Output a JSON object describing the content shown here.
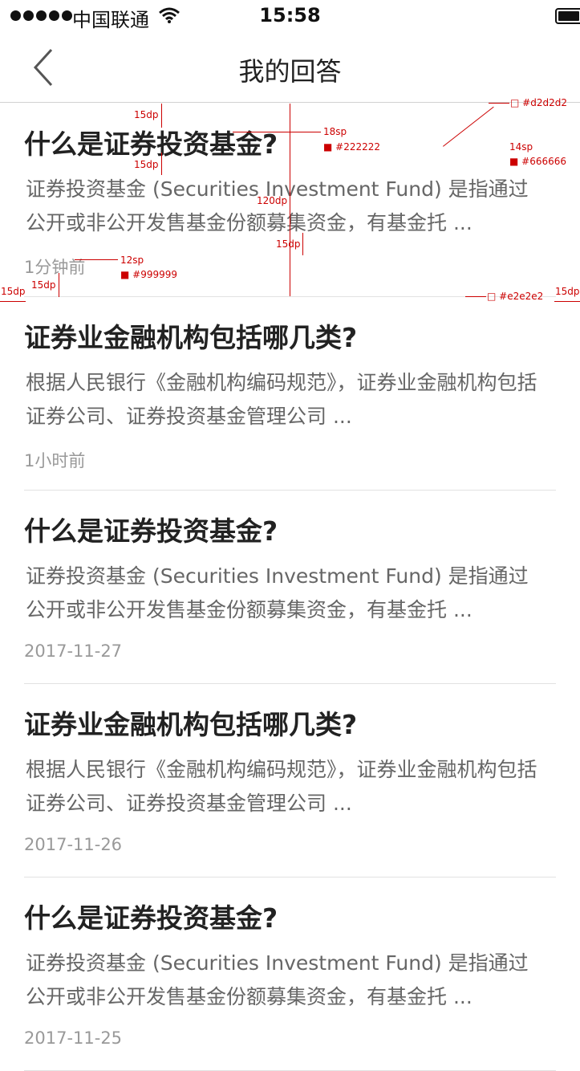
{
  "status_bar": {
    "carrier": "中国联通",
    "time": "15:58"
  },
  "nav": {
    "title": "我的回答",
    "back_icon": "chevron-left-icon"
  },
  "items": [
    {
      "title": "什么是证券投资基金?",
      "body": "证券投资基金 (Securities Investment Fund) 是指通过公开或非公开发售基金份额募集资金，有基金托 ...",
      "time": "1分钟前"
    },
    {
      "title": "证券业金融机构包括哪几类?",
      "body": "根据人民银行《金融机构编码规范》，证券业金融机构包括证券公司、证券投资基金管理公司 ...",
      "time": "1小时前"
    },
    {
      "title": "什么是证券投资基金?",
      "body": "证券投资基金 (Securities Investment Fund) 是指通过公开或非公开发售基金份额募集资金，有基金托 ...",
      "time": "2017-11-27"
    },
    {
      "title": "证券业金融机构包括哪几类?",
      "body": "根据人民银行《金融机构编码规范》，证券业金融机构包括证券公司、证券投资基金管理公司 ...",
      "time": "2017-11-26"
    },
    {
      "title": "什么是证券投资基金?",
      "body": "证券投资基金 (Securities Investment Fund) 是指通过公开或非公开发售基金份额募集资金，有基金托 ...",
      "time": "2017-11-25"
    }
  ],
  "annotations": {
    "top_gap": "15dp",
    "title_gap": "15dp",
    "item_height": "120dp",
    "body_gap": "15dp",
    "bottom_gap": "15dp",
    "left_pad": "15dp",
    "right_pad": "15dp",
    "title_size": "18sp",
    "title_color": "#222222",
    "body_size": "14sp",
    "body_color": "#666666",
    "time_size": "12sp",
    "time_color": "#999999",
    "nav_border": "#d2d2d2",
    "divider": "#e2e2e2"
  }
}
